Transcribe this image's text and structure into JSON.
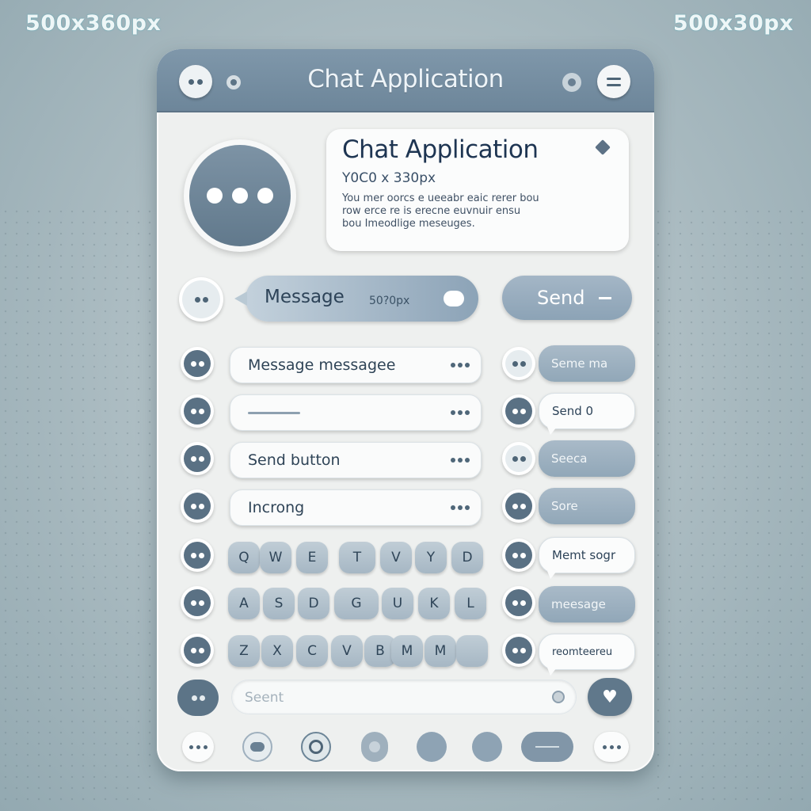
{
  "corner_labels": {
    "left": "500x360px",
    "right": "500x30px"
  },
  "titlebar": {
    "title": "Chat Application",
    "left_buttons": [
      "dots-menu-icon",
      "small-circle-icon"
    ],
    "right_buttons": [
      "small-circle-icon",
      "hamburger-menu-icon"
    ]
  },
  "profile": {
    "avatar_icon": "typing-dots-icon"
  },
  "info_card": {
    "title": "Chat Application",
    "subtitle": "Y0C0 x 330px",
    "lines": [
      "You  mer oorcs e ueeabr  eaic rerer bou",
      "row   erce re is erecne euvnuir ensu",
      "bou   Imeodlige meseuges."
    ]
  },
  "composer": {
    "message_label": "Message",
    "size_label": "50?0px",
    "send_label": "Send"
  },
  "message_rows": [
    {
      "text": "Message messagee",
      "chip": "Seme  ma",
      "chip_style": "blue"
    },
    {
      "text": "",
      "chip": "Send  0",
      "chip_style": "white"
    },
    {
      "text": "Send button",
      "chip": "Seeca",
      "chip_style": "blue"
    },
    {
      "text": "Incrong",
      "chip": "Sore",
      "chip_style": "blue"
    }
  ],
  "keyboard": {
    "row1": [
      "Q",
      "W",
      "E",
      "T",
      "V",
      "Y",
      "D"
    ],
    "row2": [
      "A",
      "S",
      "D",
      "G",
      "U",
      "K",
      "L"
    ],
    "row3": [
      "Z",
      "X",
      "C",
      "V",
      "B",
      "M",
      "M",
      ""
    ]
  },
  "keyboard_chips": [
    "Memt  sogr",
    "meesage",
    "reomteereu"
  ],
  "search": {
    "placeholder": "Seent"
  },
  "bottom_bar": [
    "dots-icon",
    "chat-icon",
    "emoji-icon",
    "record-icon",
    "circle-icon",
    "circle-icon",
    "pill-icon",
    "more-icon"
  ],
  "colors": {
    "accent": "#60788b",
    "titlebar": "#7890a3",
    "background": "#a9bac0"
  }
}
